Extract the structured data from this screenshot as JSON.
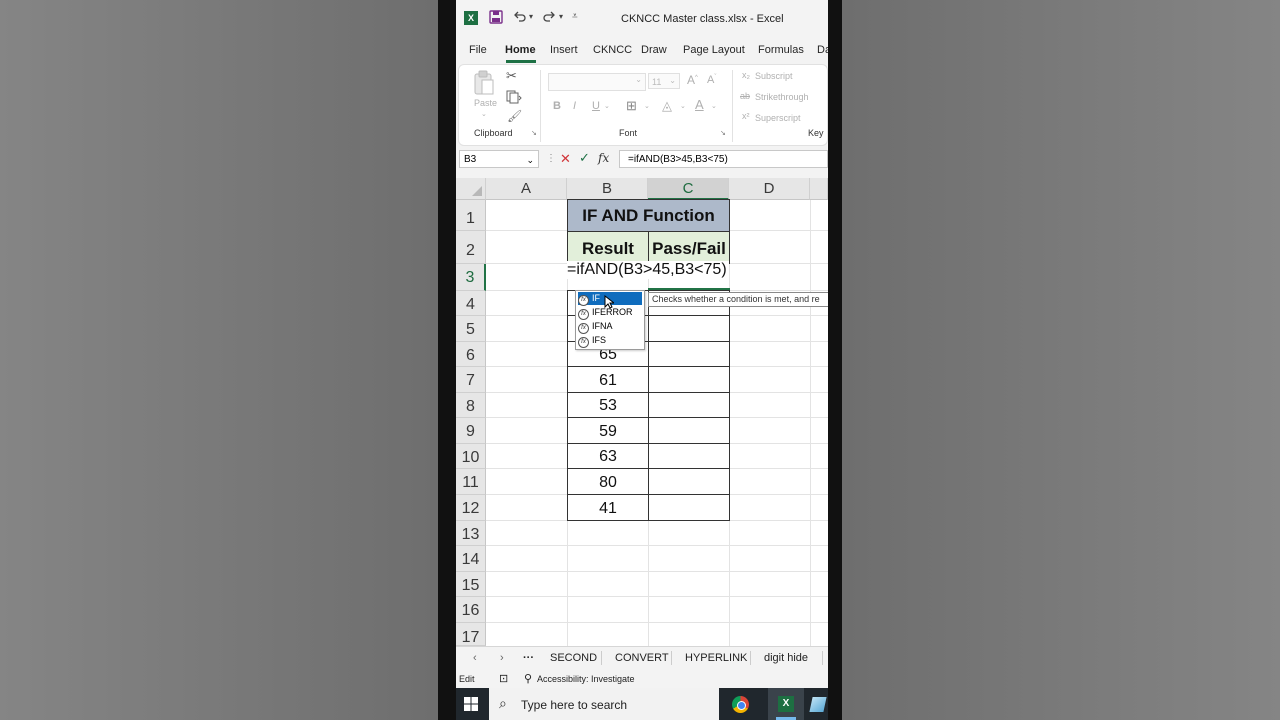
{
  "app": {
    "title": "CKNCC Master class.xlsx  -  Excel"
  },
  "ribbon_tabs": [
    "File",
    "Home",
    "Insert",
    "CKNCC",
    "Draw",
    "Page Layout",
    "Formulas",
    "Da"
  ],
  "ribbon": {
    "paste": "Paste",
    "font_name": "",
    "font_size": "11",
    "subscript": "Subscript",
    "strikethrough": "Strikethrough",
    "superscript": "Superscript",
    "groups": [
      "Clipboard",
      "Font",
      "Key"
    ]
  },
  "formula_bar": {
    "name_box": "B3",
    "formula": "=ifAND(B3>45,B3<75)",
    "fx": "fx"
  },
  "columns": [
    "A",
    "B",
    "C",
    "D"
  ],
  "rows": [
    "1",
    "2",
    "3",
    "4",
    "5",
    "6",
    "7",
    "8",
    "9",
    "10",
    "11",
    "12",
    "13",
    "14",
    "15",
    "16",
    "17"
  ],
  "table": {
    "title": "IF AND Function",
    "headers": [
      "Result",
      "Pass/Fail"
    ],
    "editing_text": "=ifAND(B3>45,B3<75)",
    "values": [
      "",
      "",
      "",
      "65",
      "61",
      "53",
      "59",
      "63",
      "80",
      "41"
    ]
  },
  "autocomplete": {
    "items": [
      "IF",
      "IFERROR",
      "IFNA",
      "IFS"
    ],
    "tooltip": "Checks whether a condition is met, and re"
  },
  "sheet_tabs": [
    "SECOND",
    "CONVERT",
    "HYPERLINK",
    "digit hide"
  ],
  "status": {
    "mode": "Edit",
    "accessibility": "Accessibility: Investigate"
  },
  "taskbar": {
    "search_placeholder": "Type here to search"
  },
  "colors": {
    "title_fill": "#adb9ca",
    "header_fill": "#e2efda",
    "excel_green": "#217346"
  }
}
